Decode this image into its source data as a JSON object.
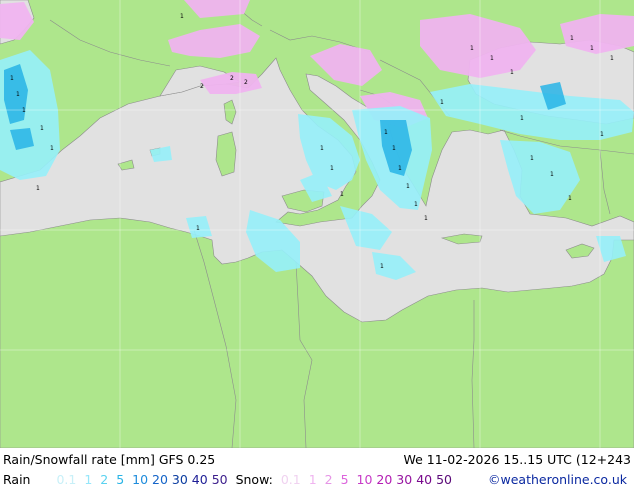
{
  "title": "Rain/Snowfall rate [mm] GFS 0.25",
  "datetime": "We 11-02-2026 15..15 UTC (12+243",
  "legend": {
    "rain_label": "Rain",
    "rain_values": [
      "0.1",
      "1",
      "2",
      "5",
      "10",
      "20",
      "30",
      "40",
      "50"
    ],
    "rain_colors": [
      "#c8f0f8",
      "#96e6fa",
      "#5ad2f0",
      "#28b4e6",
      "#1e8cdc",
      "#1464c8",
      "#0a3ca0",
      "#1e1e96",
      "#3c1e8c"
    ],
    "snow_label": "Snow:",
    "snow_values": [
      "0.1",
      "1",
      "2",
      "5",
      "10",
      "20",
      "30",
      "40",
      "50"
    ],
    "snow_colors": [
      "#f0d2f0",
      "#f0b4f0",
      "#e696e6",
      "#dc64dc",
      "#c83cc8",
      "#b41eb4",
      "#9614a0",
      "#780a8c",
      "#5a0a78"
    ]
  },
  "credit": "©weatheronline.co.uk",
  "colors": {
    "land": "#aee68c",
    "sea": "#e1e1e1",
    "border": "#969696",
    "rain": "#96f0fa",
    "snow": "#f0b4f0",
    "gridline": "#ffffff"
  }
}
